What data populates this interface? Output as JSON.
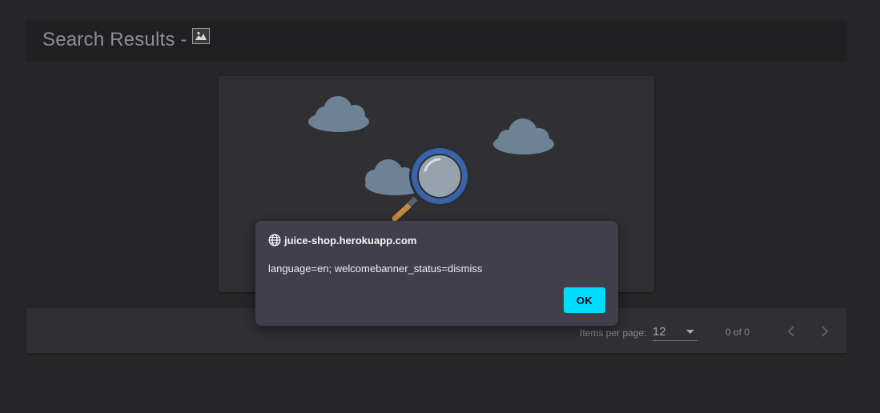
{
  "header": {
    "title": "Search Results - ",
    "title_image_icon": "broken-image-icon"
  },
  "empty_state": {
    "illustration_icon": "magnifier-with-clouds-icon"
  },
  "paginator": {
    "items_per_page_label": "Items per page:",
    "page_size": "12",
    "range_label": "0 of 0",
    "prev_icon": "chevron-left-icon",
    "next_icon": "chevron-right-icon"
  },
  "dialog": {
    "origin": "juice-shop.herokuapp.com",
    "origin_icon": "globe-icon",
    "message": "language=en; welcomebanner_status=dismiss",
    "ok_label": "OK"
  },
  "colors": {
    "background": "#272729",
    "card": "#303033",
    "dialog": "#423f4d",
    "ok_button": "#00dcff",
    "cloud": "#6e8296",
    "magnifier_ring": "#3a63a8"
  }
}
